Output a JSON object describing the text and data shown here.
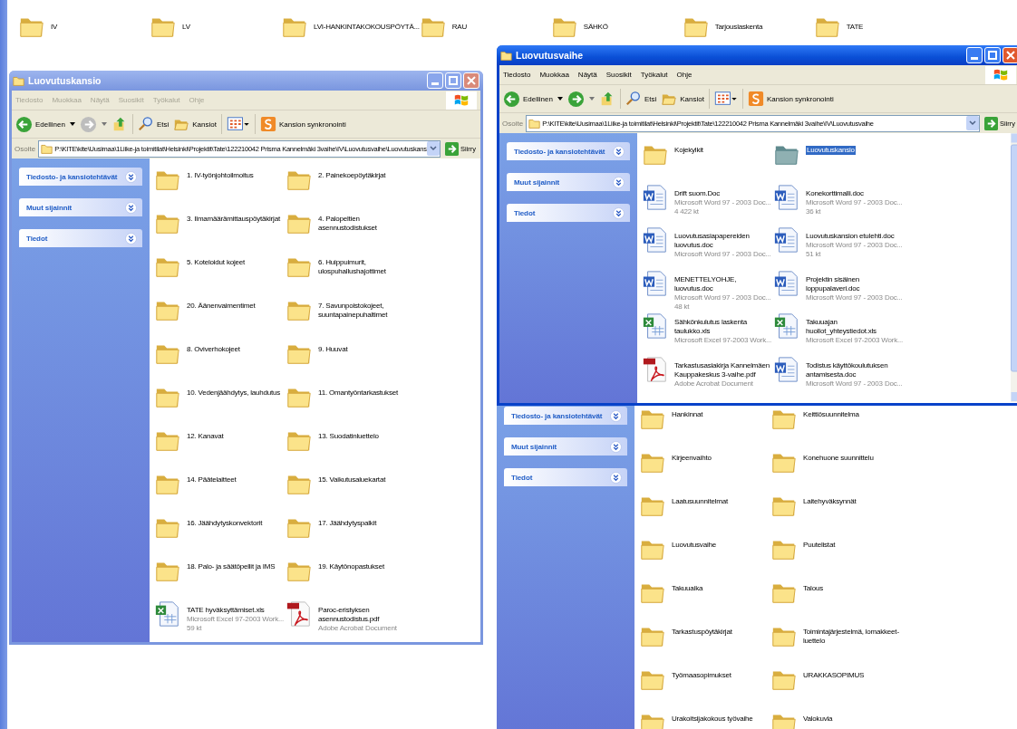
{
  "desktop_icons": [
    {
      "label": "IV"
    },
    {
      "label": "LV"
    },
    {
      "label": "LVI-HANKINTAKOKOUSPÖYTÄ..."
    },
    {
      "label": "RAU"
    },
    {
      "label": "SÄHKÖ"
    },
    {
      "label": "Tarjouslaskenta"
    },
    {
      "label": "TATE"
    }
  ],
  "back_window": {
    "sidebar": [
      "Tiedosto- ja kansiotehtävät",
      "Muut sijainnit",
      "Tiedot"
    ],
    "items": [
      {
        "kind": "folder",
        "name": "Hankinnat",
        "selected": false
      },
      {
        "kind": "folder",
        "name": "Keittiösuunnitelma",
        "selected": false
      },
      {
        "kind": "folder",
        "name": "Kirjeenvaihto",
        "selected": false
      },
      {
        "kind": "folder",
        "name": "Konehuone suunnittelu",
        "selected": false
      },
      {
        "kind": "folder",
        "name": "Laatusuunnitelmat",
        "selected": false
      },
      {
        "kind": "folder",
        "name": "Laitehyväksynnät",
        "selected": false
      },
      {
        "kind": "folder",
        "name": "Luovutusvaihe",
        "selected": false
      },
      {
        "kind": "folder",
        "name": "Puutelistat",
        "selected": false
      },
      {
        "kind": "folder",
        "name": "Takuuaika",
        "selected": false
      },
      {
        "kind": "folder",
        "name": "Talous",
        "selected": false
      },
      {
        "kind": "folder",
        "name": "Tarkastuspöytäkirjat",
        "selected": false
      },
      {
        "kind": "folder",
        "name": "Toimintajärjestelmä, lomakkeet-luettelo",
        "selected": false
      },
      {
        "kind": "folder",
        "name": "Työmaasopimukset",
        "selected": false
      },
      {
        "kind": "folder",
        "name": "URAKKASOPIMUS",
        "selected": false
      },
      {
        "kind": "folder",
        "name": "Urakoitsijakokous työvaihe",
        "selected": false
      },
      {
        "kind": "folder",
        "name": "Valokuvia",
        "selected": false
      }
    ]
  },
  "windows": [
    {
      "title": "Luovutuskansio",
      "active": false,
      "menu": [
        "Tiedosto",
        "Muokkaa",
        "Näytä",
        "Suosikit",
        "Työkalut",
        "Ohje"
      ],
      "toolbar": {
        "back": "Edellinen",
        "search": "Etsi",
        "folders": "Kansiot",
        "sync": "Kansion synkronointi"
      },
      "address_label": "Osoite",
      "address": "P:\\KITE\\kite\\Uusimaa\\1Liike-ja toimitilat\\Helsinki\\Projektit\\Tate\\122210042 Prisma Kannelmäki  3vaihe\\IV\\Luovutusvaihe\\Luovutuskans",
      "go": "Siirry",
      "sidebar": [
        "Tiedosto- ja kansiotehtävät",
        "Muut sijainnit",
        "Tiedot"
      ],
      "items": [
        {
          "kind": "folder",
          "name": "1. IV-työnjohtoilmoitus",
          "selected": false
        },
        {
          "kind": "folder",
          "name": "2. Painekoepöytäkirjat",
          "selected": false
        },
        {
          "kind": "folder",
          "name": "3. Ilmamäärämittauspöytäkirjat",
          "selected": false
        },
        {
          "kind": "folder",
          "name": "4. Palopeltien asennustodistukset",
          "selected": false
        },
        {
          "kind": "folder",
          "name": "5. Koteloidut kojeet",
          "selected": false
        },
        {
          "kind": "folder",
          "name": "6. Huippuimurit, ulospuhallushajottimet",
          "selected": false
        },
        {
          "kind": "folder",
          "name": "20. Äänenvaimentimet",
          "selected": false
        },
        {
          "kind": "folder",
          "name": "7. Savunpoistokojeet, suuntapainepuhaltimet",
          "selected": false
        },
        {
          "kind": "folder",
          "name": "8. Oviverhokojeet",
          "selected": false
        },
        {
          "kind": "folder",
          "name": "9. Huuvat",
          "selected": false
        },
        {
          "kind": "folder",
          "name": "10. Vedenjäähdytys, lauhdutus",
          "selected": false
        },
        {
          "kind": "folder",
          "name": "11. Omantyöntarkastukset",
          "selected": false
        },
        {
          "kind": "folder",
          "name": "12. Kanavat",
          "selected": false
        },
        {
          "kind": "folder",
          "name": "13. Suodatinluettelo",
          "selected": false
        },
        {
          "kind": "folder",
          "name": "14. Päätelaitteet",
          "selected": false
        },
        {
          "kind": "folder",
          "name": "15. Vaikutusaluekartat",
          "selected": false
        },
        {
          "kind": "folder",
          "name": "16. Jäähdytyskonvektorit",
          "selected": false
        },
        {
          "kind": "folder",
          "name": "17. Jäähdytyspalkit",
          "selected": false
        },
        {
          "kind": "folder",
          "name": "18. Palo- ja säätöpellit ja IMS",
          "selected": false
        },
        {
          "kind": "folder",
          "name": "19. Käytönopastukset",
          "selected": false
        },
        {
          "kind": "excel",
          "name": "TATE hyväksyttämiset.xls",
          "type": "Microsoft Excel 97-2003 Work...",
          "size": "59 kt",
          "selected": false
        },
        {
          "kind": "pdf",
          "name": "Paroc-eristyksen asennustodistus.pdf",
          "type": "Adobe Acrobat Document",
          "selected": false
        }
      ]
    },
    {
      "title": "Luovutusvaihe",
      "active": true,
      "menu": [
        "Tiedosto",
        "Muokkaa",
        "Näytä",
        "Suosikit",
        "Työkalut",
        "Ohje"
      ],
      "toolbar": {
        "back": "Edellinen",
        "search": "Etsi",
        "folders": "Kansiot",
        "sync": "Kansion synkronointi"
      },
      "address_label": "Osoite",
      "address": "P:\\KITE\\kite\\Uusimaa\\1Liike-ja toimitilat\\Helsinki\\Projektit\\Tate\\122210042 Prisma Kannelmäki  3vaihe\\IV\\Luovutusvaihe",
      "go": "Siirry",
      "sidebar": [
        "Tiedosto- ja kansiotehtävät",
        "Muut sijainnit",
        "Tiedot"
      ],
      "items": [
        {
          "kind": "folder",
          "name": "Kojekylkit",
          "selected": false
        },
        {
          "kind": "folder",
          "name": "Luovutuskansio",
          "selected": true
        },
        {
          "kind": "word",
          "name": "Drift suom.Doc",
          "type": "Microsoft Word 97 - 2003 Doc...",
          "size": "4 422 kt",
          "selected": false
        },
        {
          "kind": "word",
          "name": "Konekorttimalli.doc",
          "type": "Microsoft Word 97 - 2003 Doc...",
          "size": "36 kt",
          "selected": false
        },
        {
          "kind": "word",
          "name": "Luovutusasiapapereiden luovutus.doc",
          "type": "Microsoft Word 97 - 2003 Doc...",
          "selected": false
        },
        {
          "kind": "word",
          "name": "Luovutuskansion etulehti.doc",
          "type": "Microsoft Word 97 - 2003 Doc...",
          "size": "51 kt",
          "selected": false
        },
        {
          "kind": "word",
          "name": "MENETTELYOHJE, luovutus.doc",
          "type": "Microsoft Word 97 - 2003 Doc...",
          "size": "48 kt",
          "selected": false
        },
        {
          "kind": "word",
          "name": "Projektin sisäinen loppupalaveri.doc",
          "type": "Microsoft Word 97 - 2003 Doc...",
          "selected": false
        },
        {
          "kind": "excel",
          "name": "Sähkönkulutus laskenta taulukko.xls",
          "type": "Microsoft Excel 97-2003 Work...",
          "selected": false
        },
        {
          "kind": "excel",
          "name": "Takuuajan huollot_yhteystiedot.xls",
          "type": "Microsoft Excel 97-2003 Work...",
          "selected": false
        },
        {
          "kind": "pdf",
          "name": "Tarkastusasiakirja Kannelmäen Kauppakeskus 3-vaihe.pdf",
          "type": "Adobe Acrobat Document",
          "selected": false
        },
        {
          "kind": "word",
          "name": "Todistus käyttökoulutuksen antamisesta.doc",
          "type": "Microsoft Word 97 - 2003 Doc...",
          "selected": false
        }
      ]
    }
  ]
}
